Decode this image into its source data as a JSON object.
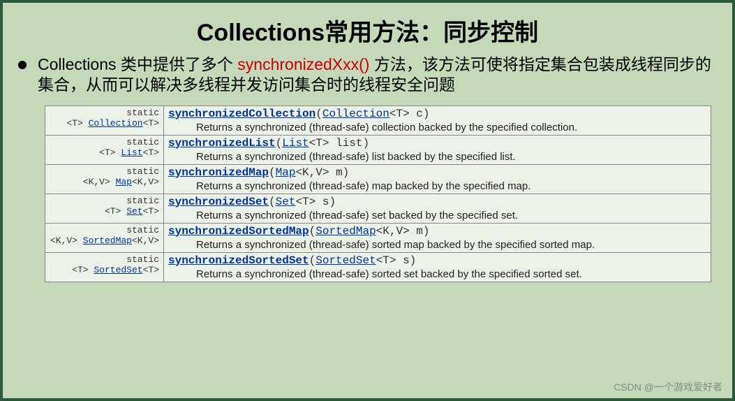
{
  "title": "Collections常用方法：同步控制",
  "description": {
    "pre": "Collections 类中提供了多个 ",
    "highlight": "synchronizedXxx()",
    "post": " 方法，该方法可使将指定集合包装成线程同步的集合，从而可以解决多线程并发访问集合时的线程安全问题"
  },
  "methods": [
    {
      "modifier_static": "static",
      "modifier_type_pre": "<T> ",
      "modifier_type_link": "Collection",
      "modifier_type_post": "<T>",
      "name": "synchronizedCollection",
      "param_open": "(",
      "param_link": "Collection",
      "param_rest": "<T> c)",
      "desc": "Returns a synchronized (thread-safe) collection backed by the specified collection."
    },
    {
      "modifier_static": "static",
      "modifier_type_pre": "<T> ",
      "modifier_type_link": "List",
      "modifier_type_post": "<T>",
      "name": "synchronizedList",
      "param_open": "(",
      "param_link": "List",
      "param_rest": "<T> list)",
      "desc": "Returns a synchronized (thread-safe) list backed by the specified list."
    },
    {
      "modifier_static": "static",
      "modifier_type_pre": "<K,V> ",
      "modifier_type_link": "Map",
      "modifier_type_post": "<K,V>",
      "name": "synchronizedMap",
      "param_open": "(",
      "param_link": "Map",
      "param_rest": "<K,V> m)",
      "desc": "Returns a synchronized (thread-safe) map backed by the specified map."
    },
    {
      "modifier_static": "static",
      "modifier_type_pre": "<T> ",
      "modifier_type_link": "Set",
      "modifier_type_post": "<T>",
      "name": "synchronizedSet",
      "param_open": "(",
      "param_link": "Set",
      "param_rest": "<T> s)",
      "desc": "Returns a synchronized (thread-safe) set backed by the specified set."
    },
    {
      "modifier_static": "static",
      "modifier_type_pre": "<K,V> ",
      "modifier_type_link": "SortedMap",
      "modifier_type_post": "<K,V>",
      "name": "synchronizedSortedMap",
      "param_open": "(",
      "param_link": "SortedMap",
      "param_rest": "<K,V> m)",
      "desc": "Returns a synchronized (thread-safe) sorted map backed by the specified sorted map."
    },
    {
      "modifier_static": "static",
      "modifier_type_pre": "<T> ",
      "modifier_type_link": "SortedSet",
      "modifier_type_post": "<T>",
      "name": "synchronizedSortedSet",
      "param_open": "(",
      "param_link": "SortedSet",
      "param_rest": "<T> s)",
      "desc": "Returns a synchronized (thread-safe) sorted set backed by the specified sorted set."
    }
  ],
  "watermark": "CSDN @一个游戏爱好者"
}
